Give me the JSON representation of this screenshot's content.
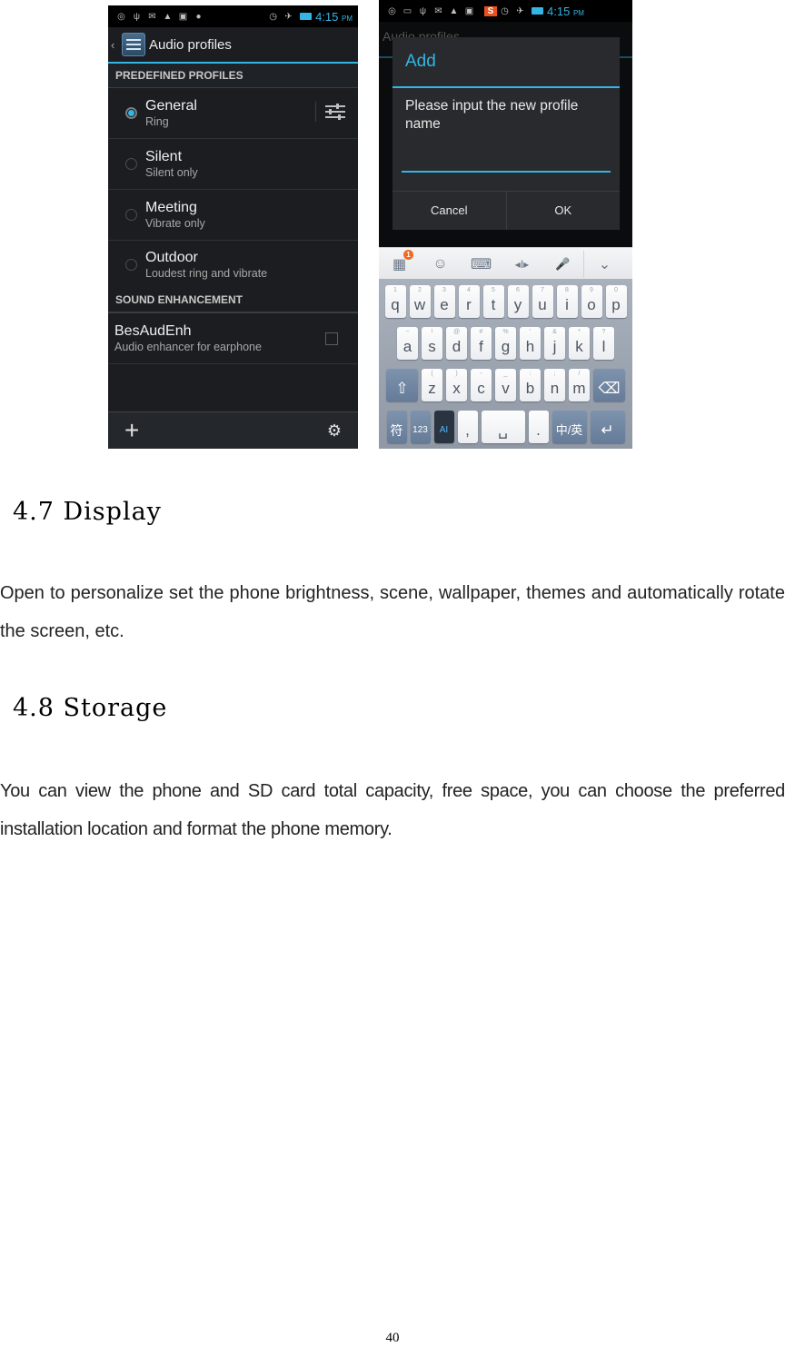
{
  "screenshots": {
    "audio_profiles": {
      "status_bar": {
        "icons": [
          "gps-icon",
          "usb-icon",
          "gmail-icon",
          "warning-icon",
          "message-icon",
          "android-icon",
          "alarm-icon",
          "airplane-icon",
          "battery-icon"
        ],
        "time": "4:15",
        "ampm": "PM"
      },
      "action_bar": {
        "back": "‹",
        "title": "Audio profiles"
      },
      "sections": {
        "predefined": "PREDEFINED PROFILES",
        "enhancement": "SOUND ENHANCEMENT"
      },
      "profiles": [
        {
          "name": "General",
          "summary": "Ring",
          "selected": true
        },
        {
          "name": "Silent",
          "summary": "Silent only",
          "selected": false
        },
        {
          "name": "Meeting",
          "summary": "Vibrate only",
          "selected": false
        },
        {
          "name": "Outdoor",
          "summary": "Loudest ring and vibrate",
          "selected": false
        }
      ],
      "enhancement_item": {
        "name": "BesAudEnh",
        "summary": "Audio enhancer for earphone",
        "checked": false
      },
      "bottom_bar": {
        "add": "+",
        "reset": "⚙"
      }
    },
    "add_dialog": {
      "status_bar": {
        "icons": [
          "gps-icon",
          "keyboard-icon",
          "usb-icon",
          "gmail-icon",
          "warning-icon",
          "message-icon",
          "sogou-icon",
          "alarm-icon",
          "airplane-icon",
          "battery-icon"
        ],
        "time": "4:15",
        "ampm": "PM"
      },
      "background_title": "Audio profiles",
      "dialog": {
        "title": "Add",
        "message": "Please input the new profile name",
        "input_value": "",
        "cancel": "Cancel",
        "ok": "OK"
      },
      "keyboard": {
        "toolbar": {
          "apps_badge": "1",
          "emoji": "☺",
          "keyboard": "⌨",
          "cursor": "◂I▸",
          "mic": "🎤",
          "collapse": "⌄"
        },
        "row1": [
          {
            "k": "q",
            "h": "1"
          },
          {
            "k": "w",
            "h": "2"
          },
          {
            "k": "e",
            "h": "3"
          },
          {
            "k": "r",
            "h": "4"
          },
          {
            "k": "t",
            "h": "5"
          },
          {
            "k": "y",
            "h": "6"
          },
          {
            "k": "u",
            "h": "7"
          },
          {
            "k": "i",
            "h": "8"
          },
          {
            "k": "o",
            "h": "9"
          },
          {
            "k": "p",
            "h": "0"
          }
        ],
        "row2": [
          {
            "k": "a",
            "h": "~"
          },
          {
            "k": "s",
            "h": "!"
          },
          {
            "k": "d",
            "h": "@"
          },
          {
            "k": "f",
            "h": "#"
          },
          {
            "k": "g",
            "h": "%"
          },
          {
            "k": "h",
            "h": "'"
          },
          {
            "k": "j",
            "h": "&"
          },
          {
            "k": "k",
            "h": "*"
          },
          {
            "k": "l",
            "h": "?"
          }
        ],
        "row3": [
          {
            "k": "z",
            "h": "("
          },
          {
            "k": "x",
            "h": ")"
          },
          {
            "k": "c",
            "h": "-"
          },
          {
            "k": "v",
            "h": "_"
          },
          {
            "k": "b",
            "h": ":"
          },
          {
            "k": "n",
            "h": ";"
          },
          {
            "k": "m",
            "h": "/"
          }
        ],
        "shift": "⇧",
        "backspace": "⌫",
        "symbols": "符",
        "numbers": "123",
        "ai": "AI",
        "comma": ",",
        "space": "␣",
        "period": ".",
        "lang": "中/英",
        "enter": "↵"
      }
    }
  },
  "sections": [
    {
      "heading": "4.7 Display",
      "body": "Open to personalize set the phone brightness, scene, wallpaper, themes and automatically rotate the screen, etc."
    },
    {
      "heading": "4.8 Storage",
      "body": "You can view the phone and SD card total capacity, free space, you can choose the preferred installation location and format the phone memory."
    }
  ],
  "page_number": "40"
}
